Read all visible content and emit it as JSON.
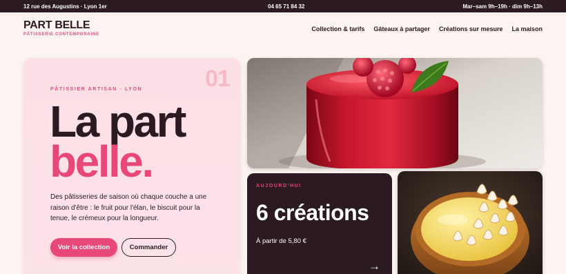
{
  "topbar": {
    "address": "12 rue des Augustins · Lyon 1er",
    "phone": "04 65 71 84 32",
    "hours": "Mar–sam 9h–19h · dim 9h–13h"
  },
  "brand": {
    "name": "PART BELLE",
    "tagline": "PÂTISSERIE CONTEMPORAINE"
  },
  "nav": {
    "items": [
      {
        "label": "Collection & tarifs"
      },
      {
        "label": "Gâteaux à partager"
      },
      {
        "label": "Créations sur mesure"
      },
      {
        "label": "La maison"
      }
    ]
  },
  "hero": {
    "number": "01",
    "eyebrow": "PÂTISSIER ARTISAN · LYON",
    "title_line1": "La part",
    "title_line2": "belle.",
    "description": "Des pâtisseries de saison où chaque couche a une raison d'être : le fruit pour l'élan, le biscuit pour la tenue, le crémeux pour la longueur.",
    "primary_button": "Voir la collection",
    "secondary_button": "Commander"
  },
  "today_card": {
    "eyebrow": "AUJOURD'HUI",
    "count": "6 créations",
    "price": "À partir de 5,80 €",
    "arrow": "→"
  },
  "colors": {
    "accent": "#e8477a",
    "dark": "#2b1a22",
    "background": "#fdf3f1",
    "hero_card": "#fde0e7"
  }
}
